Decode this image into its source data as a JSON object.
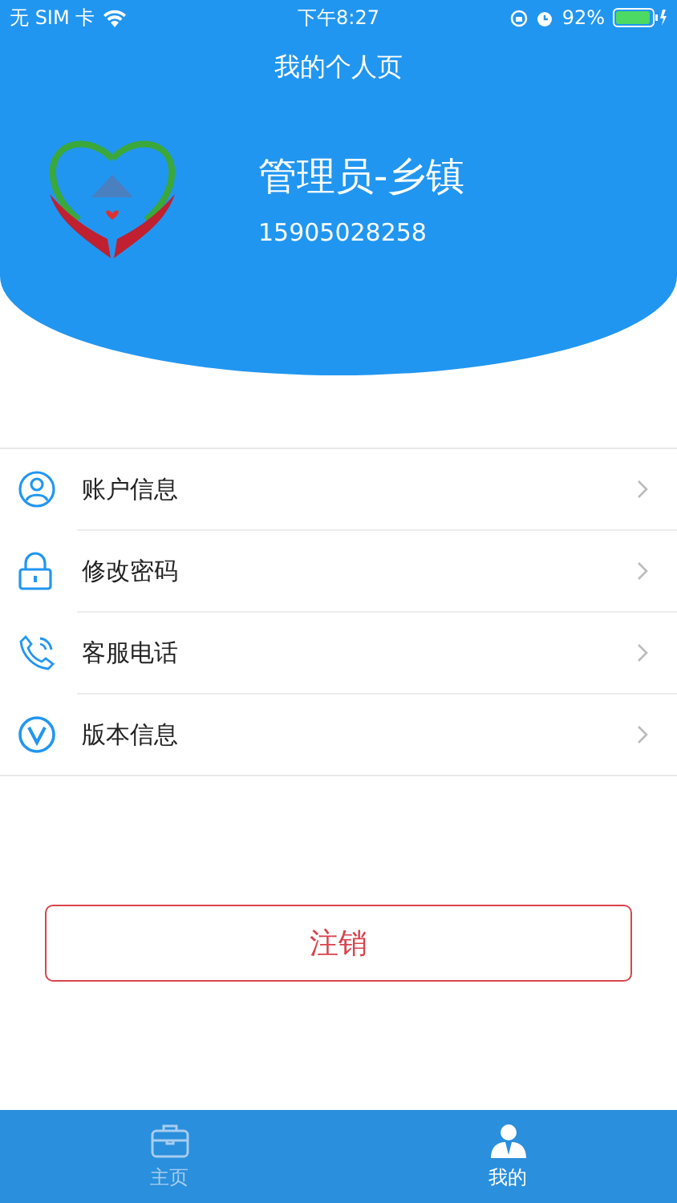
{
  "status_bar": {
    "carrier": "无 SIM 卡",
    "time": "下午8:27",
    "battery": "92%"
  },
  "title": "我的个人页",
  "profile": {
    "name": "管理员-乡镇",
    "phone": "15905028258"
  },
  "menu": [
    {
      "kind": "account",
      "label": "账户信息"
    },
    {
      "kind": "password",
      "label": "修改密码"
    },
    {
      "kind": "phone",
      "label": "客服电话"
    },
    {
      "kind": "version",
      "label": "版本信息"
    }
  ],
  "logout": "注销",
  "tabs": [
    {
      "kind": "home",
      "label": "主页",
      "selected": false
    },
    {
      "kind": "mine",
      "label": "我的",
      "selected": true
    }
  ]
}
